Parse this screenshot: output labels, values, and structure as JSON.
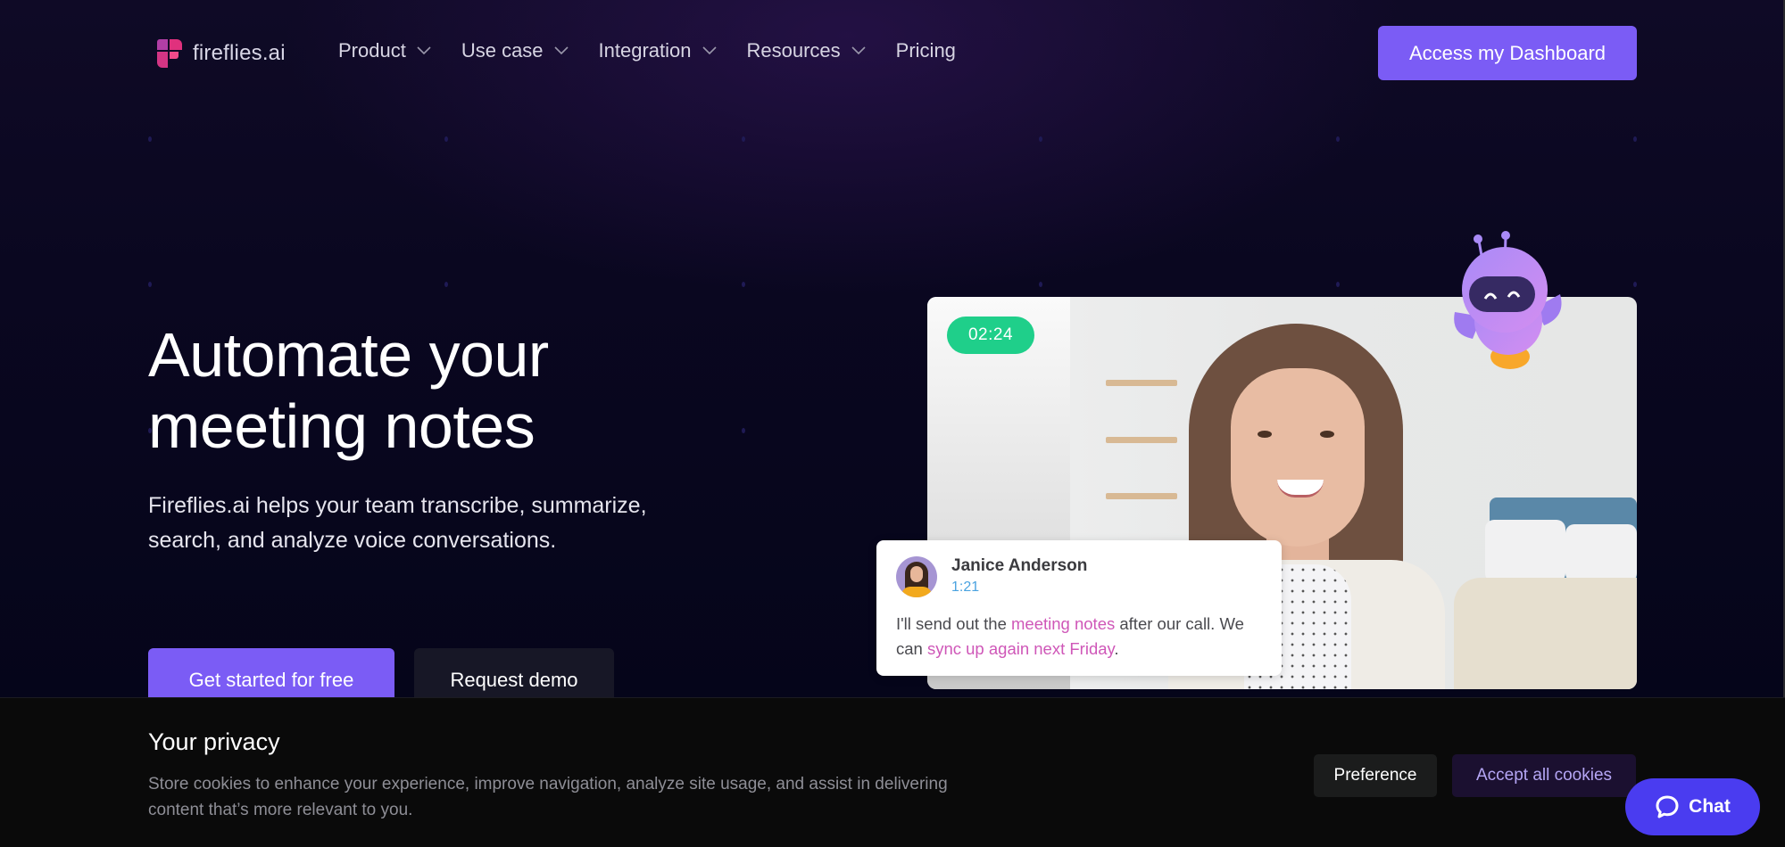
{
  "brand": {
    "name": "fireflies.ai",
    "logo_icon": "fireflies-logo-icon"
  },
  "nav": {
    "items": [
      {
        "label": "Product",
        "has_dropdown": true
      },
      {
        "label": "Use case",
        "has_dropdown": true
      },
      {
        "label": "Integration",
        "has_dropdown": true
      },
      {
        "label": "Resources",
        "has_dropdown": true
      },
      {
        "label": "Pricing",
        "has_dropdown": false
      }
    ],
    "dashboard_button": "Access my Dashboard"
  },
  "hero": {
    "title_line1": "Automate your",
    "title_line2": "meeting notes",
    "subtitle": "Fireflies.ai helps your team transcribe, summarize, search, and analyze voice conversations.",
    "cta_primary": "Get started for free",
    "cta_secondary": "Request demo"
  },
  "video_preview": {
    "timer": "02:24",
    "mascot_icon": "robot-mascot-icon",
    "transcript": {
      "speaker": "Janice Anderson",
      "timestamp": "1:21",
      "segments": [
        {
          "text": "I'll send out the ",
          "highlight": false
        },
        {
          "text": "meeting notes",
          "highlight": true
        },
        {
          "text": " after our call. We can ",
          "highlight": false
        },
        {
          "text": "sync up again next Friday",
          "highlight": true
        },
        {
          "text": ".",
          "highlight": false
        }
      ]
    }
  },
  "cookie_banner": {
    "title": "Your privacy",
    "text": "Store cookies to enhance your experience, improve navigation, analyze site usage, and assist in delivering content that’s more relevant to you.",
    "preference_button": "Preference",
    "accept_button": "Accept all cookies"
  },
  "chat_widget": {
    "label": "Chat",
    "icon": "chat-bubble-icon"
  },
  "colors": {
    "accent": "#7b5cf5",
    "timer_green": "#1fcf8a",
    "highlight_pink": "#cf57b8",
    "timestamp_blue": "#4aa3e0",
    "chat_blue": "#4a3cf0",
    "page_bg": "#05051a",
    "banner_bg": "#0a0a0a"
  }
}
